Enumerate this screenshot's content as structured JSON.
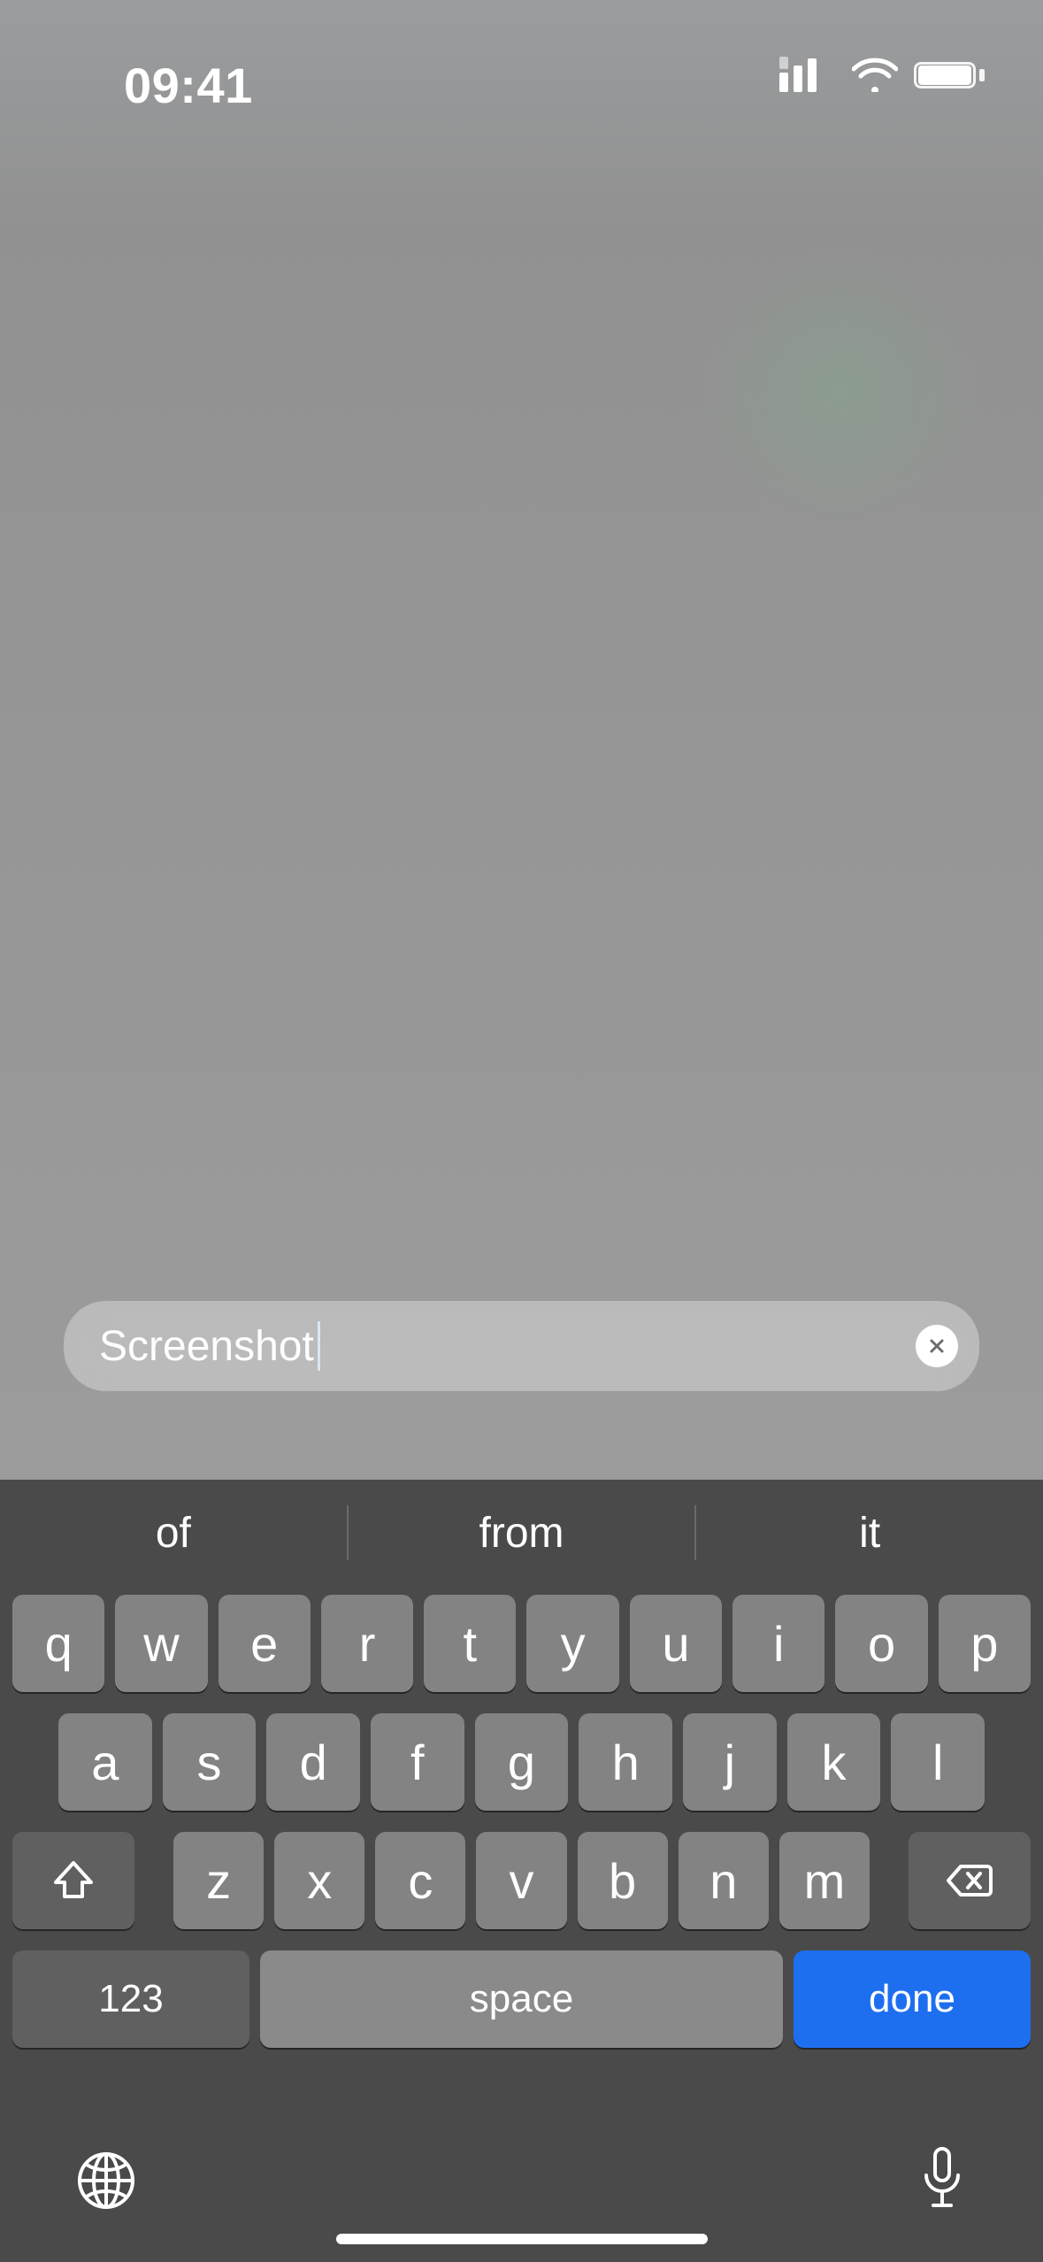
{
  "status": {
    "time": "09:41",
    "icons": {
      "cellular": "cellular-icon",
      "wifi": "wifi-icon",
      "battery": "battery-icon"
    }
  },
  "search": {
    "value": "Screenshot",
    "clear_label": "Clear"
  },
  "suggestions": [
    "of",
    "from",
    "it"
  ],
  "keys": {
    "row1": [
      "q",
      "w",
      "e",
      "r",
      "t",
      "y",
      "u",
      "i",
      "o",
      "p"
    ],
    "row2": [
      "a",
      "s",
      "d",
      "f",
      "g",
      "h",
      "j",
      "k",
      "l"
    ],
    "row3": [
      "z",
      "x",
      "c",
      "v",
      "b",
      "n",
      "m"
    ],
    "shift_label": "Shift",
    "delete_label": "Delete",
    "numbers_label": "123",
    "space_label": "space",
    "done_label": "done"
  },
  "bottom": {
    "globe_label": "Switch Keyboard",
    "mic_label": "Dictate"
  }
}
